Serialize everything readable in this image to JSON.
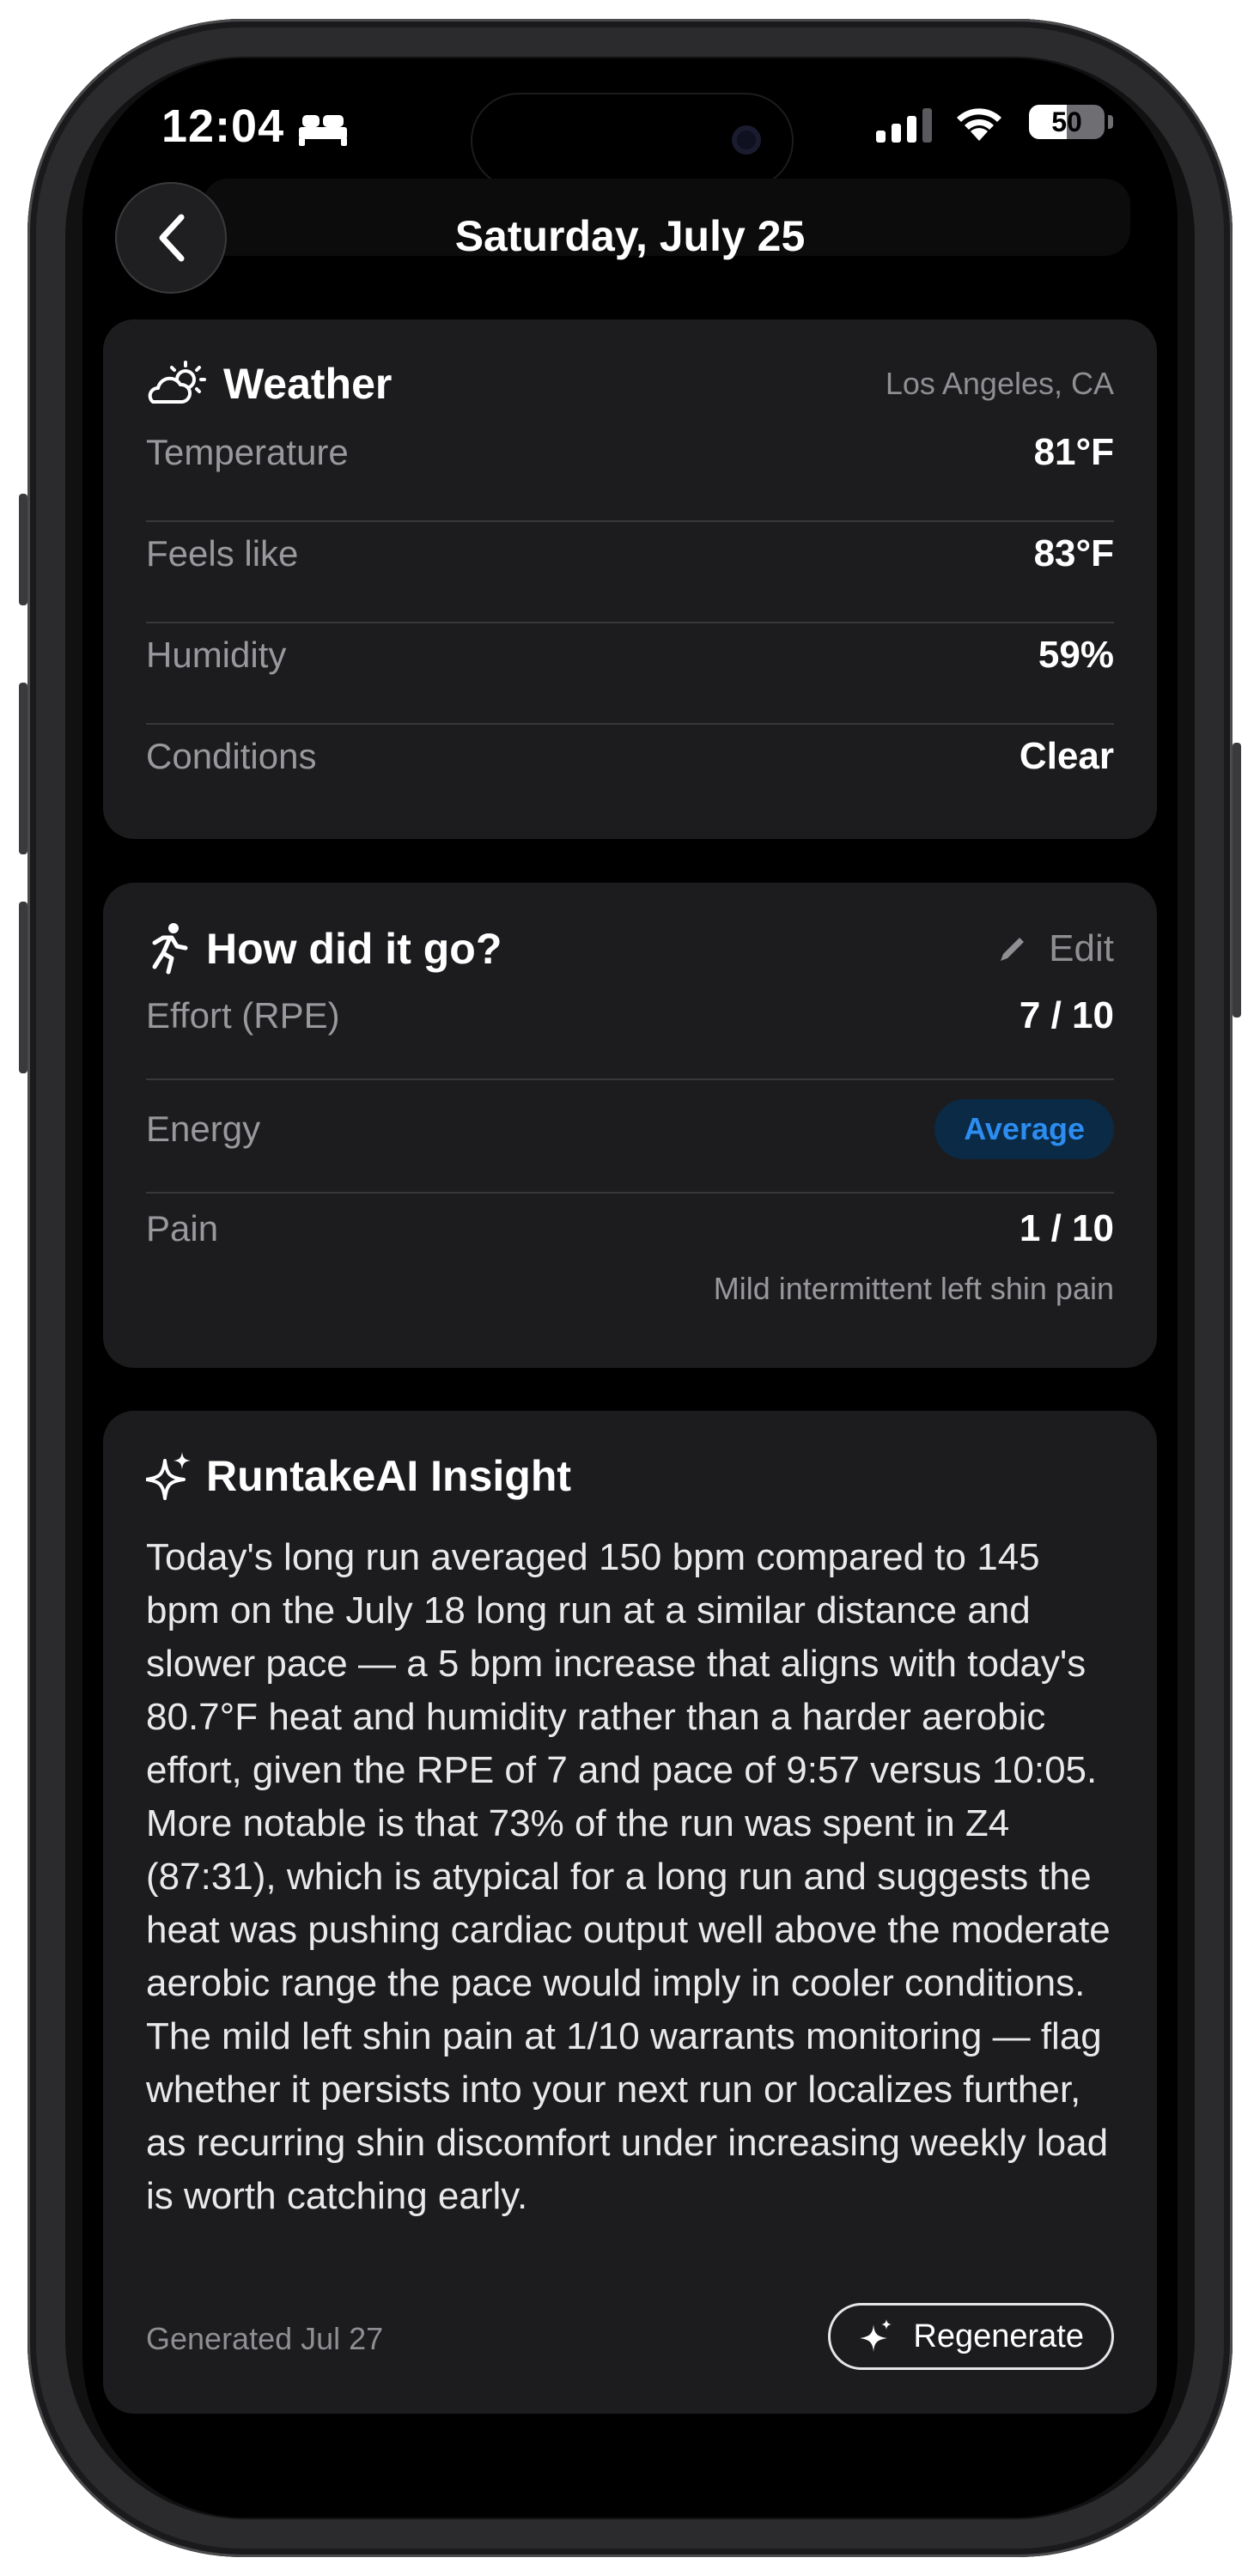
{
  "status_bar": {
    "time": "12:04",
    "battery_percent": "50",
    "battery_level": 0.5
  },
  "header": {
    "title": "Saturday, July 25"
  },
  "weather": {
    "title": "Weather",
    "location": "Los Angeles, CA",
    "rows": [
      {
        "label": "Temperature",
        "value": "81°F"
      },
      {
        "label": "Feels like",
        "value": "83°F"
      },
      {
        "label": "Humidity",
        "value": "59%"
      },
      {
        "label": "Conditions",
        "value": "Clear"
      }
    ]
  },
  "feedback": {
    "title": "How did it go?",
    "edit_label": "Edit",
    "effort_label": "Effort (RPE)",
    "effort_value": "7 / 10",
    "energy_label": "Energy",
    "energy_value": "Average",
    "pain_label": "Pain",
    "pain_value": "1 / 10",
    "pain_note": "Mild intermittent left shin pain"
  },
  "insight": {
    "title": "RuntakeAI Insight",
    "text": "Today's long run averaged 150 bpm compared to 145 bpm on the July 18 long run at a similar distance and slower pace — a 5 bpm increase that aligns with today's 80.7°F heat and humidity rather than a harder aerobic effort, given the RPE of 7 and pace of 9:57 versus 10:05. More notable is that 73% of the run was spent in Z4 (87:31), which is atypical for a long run and suggests the heat was pushing cardiac output well above the moderate aerobic range the pace would imply in cooler conditions. The mild left shin pain at 1/10 warrants monitoring — flag whether it persists into your next run or localizes further, as recurring shin discomfort under increasing weekly load is worth catching early.",
    "generated": "Generated Jul 27",
    "regenerate_label": "Regenerate"
  },
  "colors": {
    "background": "#000000",
    "card": "#1c1c1e",
    "accent_blue": "#2d8cf0",
    "badge_bg": "#0a2a45"
  }
}
